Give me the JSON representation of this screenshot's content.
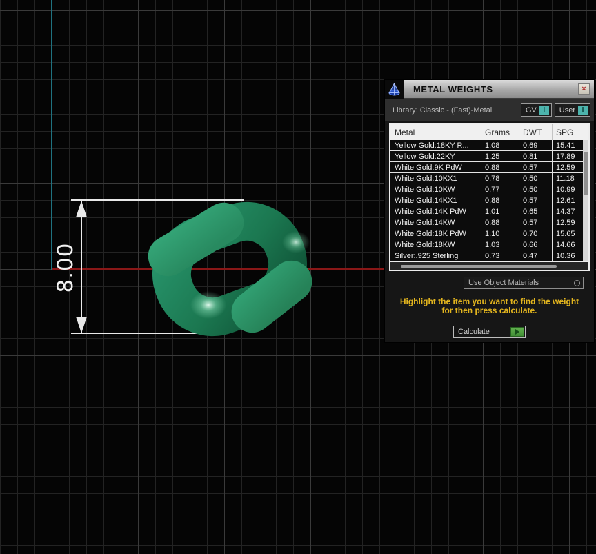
{
  "viewport": {
    "dimension_label": "8.00",
    "x_axis_color": "#8a1717",
    "y_axis_color": "#1f7280",
    "ring_color": "#2f9e72"
  },
  "dialog": {
    "title": "METAL WEIGHTS",
    "close_label": "×",
    "library_label": "Library: Classic - (Fast)-Metal",
    "toggles": [
      {
        "label": "GV",
        "indicator": "I"
      },
      {
        "label": "User",
        "indicator": "I"
      }
    ],
    "table": {
      "columns": [
        "Metal",
        "Grams",
        "DWT",
        "SPG"
      ],
      "rows": [
        [
          "Yellow Gold:18KY R...",
          "1.08",
          "0.69",
          "15.41"
        ],
        [
          "Yellow Gold:22KY",
          "1.25",
          "0.81",
          "17.89"
        ],
        [
          "White Gold:9K PdW",
          "0.88",
          "0.57",
          "12.59"
        ],
        [
          "White Gold:10KX1",
          "0.78",
          "0.50",
          "11.18"
        ],
        [
          "White Gold:10KW",
          "0.77",
          "0.50",
          "10.99"
        ],
        [
          "White Gold:14KX1",
          "0.88",
          "0.57",
          "12.61"
        ],
        [
          "White Gold:14K PdW",
          "1.01",
          "0.65",
          "14.37"
        ],
        [
          "White Gold:14KW",
          "0.88",
          "0.57",
          "12.59"
        ],
        [
          "White Gold:18K PdW",
          "1.10",
          "0.70",
          "15.65"
        ],
        [
          "White Gold:18KW",
          "1.03",
          "0.66",
          "14.66"
        ],
        [
          "Silver:.925 Sterling",
          "0.73",
          "0.47",
          "10.36"
        ]
      ]
    },
    "materials_button_label": "Use Object Materials",
    "instruction_line1": "Highlight the item you want to find the weight",
    "instruction_line2": "for then press calculate.",
    "calculate_button_label": "Calculate",
    "accent_yellow": "#e3b51e"
  }
}
